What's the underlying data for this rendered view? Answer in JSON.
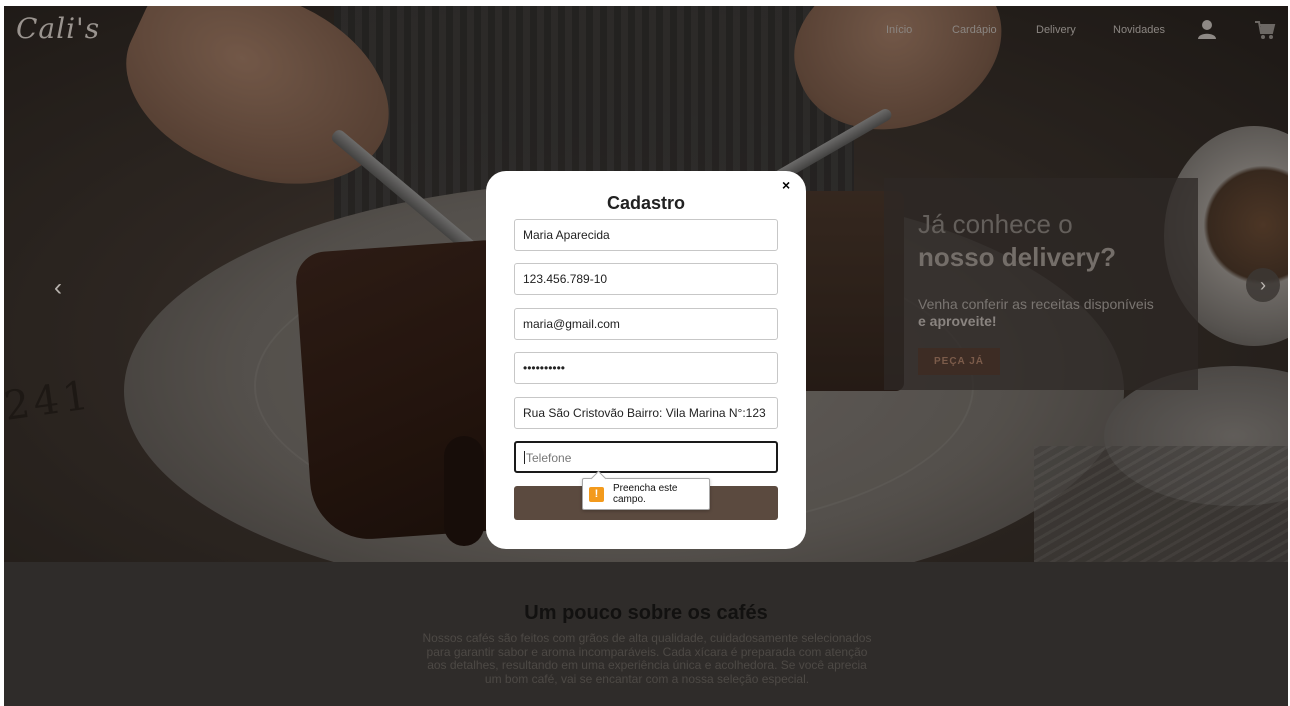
{
  "brand": {
    "logo": "Cali's"
  },
  "nav": {
    "links": [
      "Início",
      "Cardápio",
      "Delivery",
      "Novidades"
    ]
  },
  "icons": {
    "user": "user-icon",
    "cart": "cart-icon",
    "prev": "chevron-left-icon",
    "next": "chevron-right-icon",
    "close": "close-icon",
    "warning": "warning-icon"
  },
  "hero": {
    "prev_label": "‹",
    "next_label": "›",
    "promo": {
      "title_line1": "Já conhece o",
      "title_line2": "nosso delivery?",
      "text_line1": "Venha conferir as receitas disponíveis",
      "text_line2": "e aproveite!",
      "button": "PEÇA JÁ"
    },
    "stamp": "241"
  },
  "modal": {
    "close": "×",
    "title": "Cadastro",
    "fields": {
      "name": "Maria Aparecida",
      "cpf": "123.456.789-10",
      "email": "maria@gmail.com",
      "password": "••••••••••",
      "address": "Rua São Cristovão Bairro: Vila Marina  N°:123",
      "phone_placeholder": "Telefone"
    },
    "validation": {
      "icon": "!",
      "message": "Preencha este campo."
    }
  },
  "about": {
    "title": "Um pouco sobre os cafés",
    "text": "Nossos cafés são feitos com grãos de alta qualidade, cuidadosamente selecionados para garantir sabor e aroma incomparáveis. Cada xícara é preparada com atenção aos detalhes, resultando em uma experiência única e acolhedora. Se você aprecia um bom café, vai se encantar com a nossa seleção especial."
  },
  "colors": {
    "submit": "#5b4a3f",
    "warning": "#f39a1c",
    "promo_button": "#3d2c24"
  }
}
